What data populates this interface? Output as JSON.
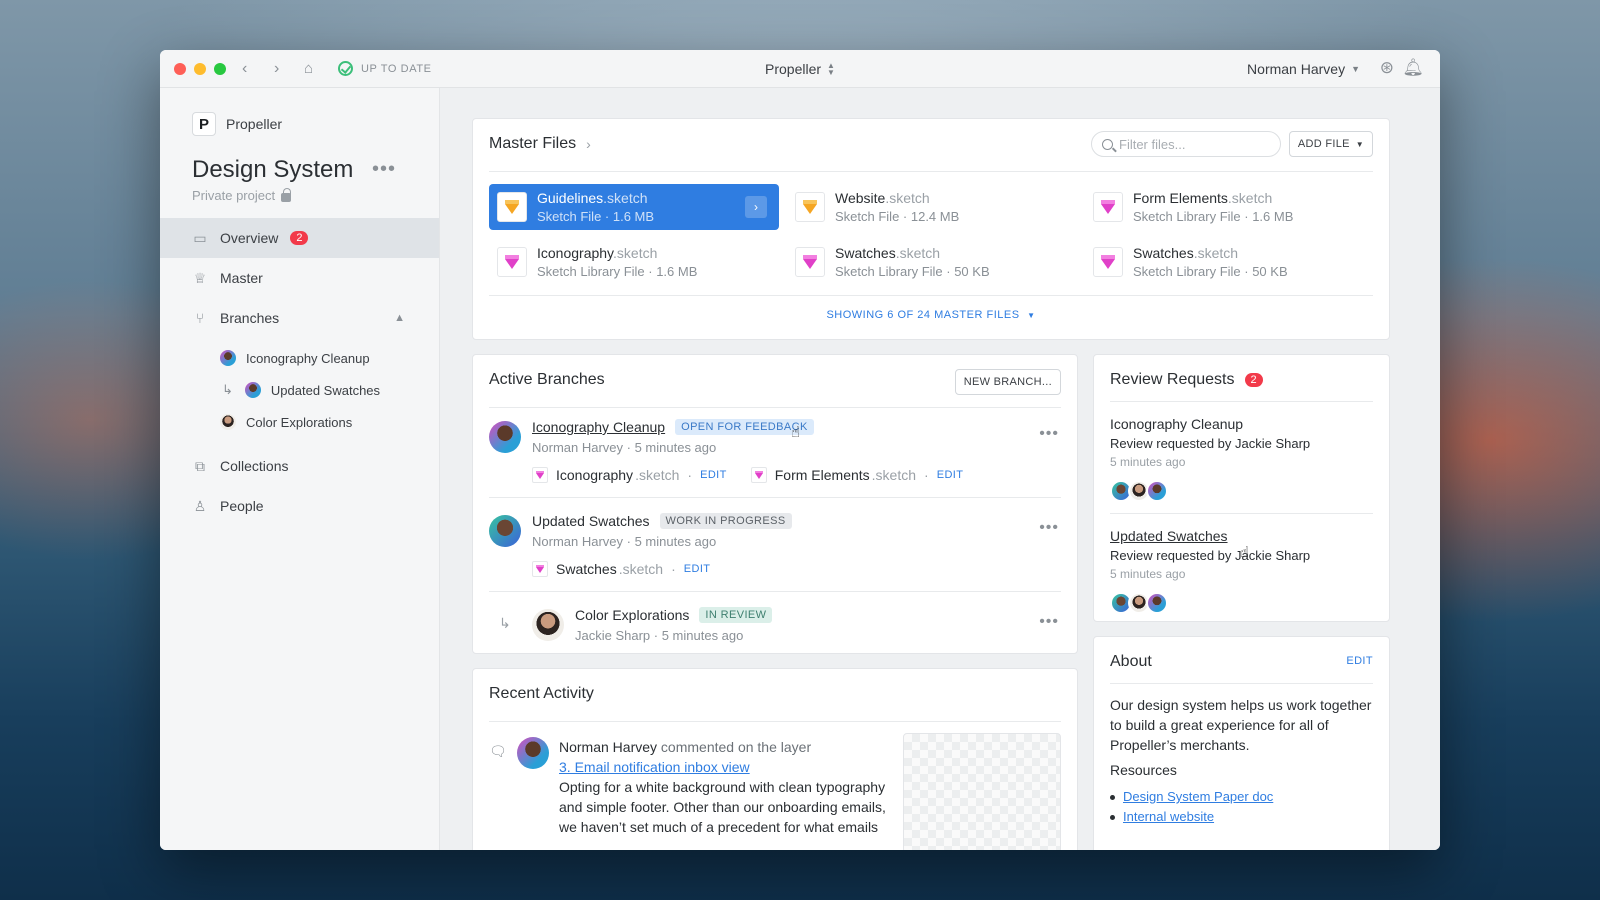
{
  "titlebar": {
    "status": "UP TO DATE",
    "project": "Propeller",
    "user": "Norman Harvey"
  },
  "sidebar": {
    "project_name": "Propeller",
    "title": "Design System",
    "subtitle": "Private project",
    "nav": [
      {
        "label": "Overview",
        "badge": "2"
      },
      {
        "label": "Master"
      },
      {
        "label": "Branches"
      },
      {
        "label": "Collections"
      },
      {
        "label": "People"
      }
    ],
    "branches": [
      "Iconography Cleanup",
      "Updated Swatches",
      "Color Explorations"
    ]
  },
  "master_files": {
    "title": "Master Files",
    "filter_placeholder": "Filter files...",
    "add_file": "ADD FILE",
    "files": [
      {
        "name": "Guidelines",
        "ext": ".sketch",
        "meta": "Sketch File · 1.6 MB"
      },
      {
        "name": "Website",
        "ext": ".sketch",
        "meta": "Sketch File · 12.4 MB"
      },
      {
        "name": "Form Elements",
        "ext": ".sketch",
        "meta": "Sketch Library File · 1.6 MB"
      },
      {
        "name": "Iconography",
        "ext": ".sketch",
        "meta": "Sketch Library File · 1.6 MB"
      },
      {
        "name": "Swatches",
        "ext": ".sketch",
        "meta": "Sketch Library File · 50 KB"
      },
      {
        "name": "Swatches",
        "ext": ".sketch",
        "meta": "Sketch Library File · 50 KB"
      }
    ],
    "showing": "SHOWING 6 OF 24 MASTER FILES"
  },
  "active_branches": {
    "title": "Active Branches",
    "new_branch": "NEW BRANCH...",
    "items": [
      {
        "name": "Iconography Cleanup",
        "tag": "OPEN FOR FEEDBACK",
        "meta": "Norman Harvey · 5 minutes ago",
        "files": [
          {
            "name": "Iconography",
            "ext": ".sketch"
          },
          {
            "name": "Form Elements",
            "ext": ".sketch"
          }
        ]
      },
      {
        "name": "Updated Swatches",
        "tag": "WORK IN PROGRESS",
        "meta": "Norman Harvey · 5 minutes ago",
        "files": [
          {
            "name": "Swatches",
            "ext": ".sketch"
          }
        ]
      },
      {
        "name": "Color Explorations",
        "tag": "IN REVIEW",
        "meta": "Jackie Sharp · 5 minutes ago"
      }
    ],
    "edit_label": "EDIT"
  },
  "review_requests": {
    "title": "Review Requests",
    "badge": "2",
    "items": [
      {
        "title": "Iconography Cleanup",
        "requested": "Review requested by Jackie Sharp",
        "time": "5 minutes ago"
      },
      {
        "title": "Updated Swatches",
        "requested": "Review requested by Jackie Sharp",
        "time": "5 minutes ago"
      }
    ]
  },
  "about": {
    "title": "About",
    "edit": "EDIT",
    "text": "Our design system helps us work together to build a great experience for all of Propeller’s merchants.",
    "resources_label": "Resources",
    "resources": [
      "Design System Paper doc",
      "Internal website"
    ]
  },
  "recent_activity": {
    "title": "Recent Activity",
    "user": "Norman Harvey",
    "action": "commented on the layer",
    "layer_link": "3. Email notification inbox view",
    "comment": "Opting for a white background with clean typography and simple footer. Other than our onboarding emails, we haven’t set much of a precedent for what emails"
  }
}
